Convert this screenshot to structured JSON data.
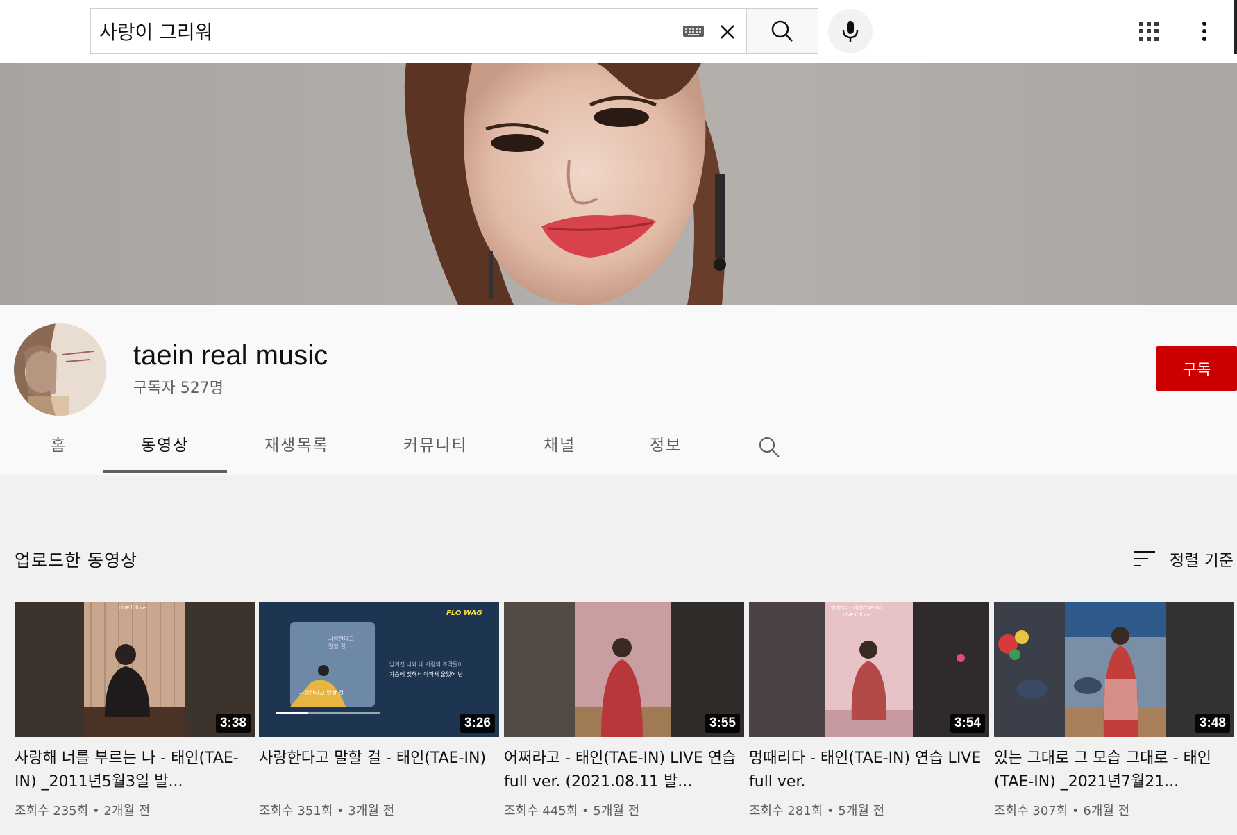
{
  "search": {
    "query": "사랑이 그리워"
  },
  "channel": {
    "name": "taein real music",
    "subscribers": "구독자 527명",
    "subscribe_label": "구독",
    "accent_color": "#cc0000"
  },
  "tabs": [
    {
      "label": "홈"
    },
    {
      "label": "동영상"
    },
    {
      "label": "재생목록"
    },
    {
      "label": "커뮤니티"
    },
    {
      "label": "채널"
    },
    {
      "label": "정보"
    }
  ],
  "active_tab": "동영상",
  "section": {
    "title": "업로드한 동영상",
    "sort_label": "정렬 기준"
  },
  "videos": [
    {
      "title": "사랑해 너를 부르는 나 - 태인(TAE-IN) _2011년5월3일 발...",
      "duration": "3:38",
      "views": "조회수 235회",
      "age": "2개월 전"
    },
    {
      "title": "사랑한다고 말할 걸 - 태인(TAE-IN)",
      "duration": "3:26",
      "views": "조회수 351회",
      "age": "3개월 전"
    },
    {
      "title": "어쩌라고 - 태인(TAE-IN) LIVE 연습 full ver. (2021.08.11 발...",
      "duration": "3:55",
      "views": "조회수 445회",
      "age": "5개월 전"
    },
    {
      "title": "멍때리다 - 태인(TAE-IN) 연습 LIVE full ver.",
      "duration": "3:54",
      "views": "조회수 281회",
      "age": "5개월 전"
    },
    {
      "title": "있는 그대로 그 모습 그대로 - 태인(TAE-IN) _2021년7월21...",
      "duration": "3:48",
      "views": "조회수 307회",
      "age": "6개월 전"
    }
  ],
  "thumb_text": {
    "v1_caption": "LIVE full ver.",
    "v2_logo": "FLO WAG",
    "v2_song": "사랑한다고 말할 걸",
    "v2_lyric1": "남겨진 너와 내 사랑의 조각들이",
    "v2_lyric2": "가슴에 맺혀서 아파서 울었어 난",
    "v4_caption1": "멍때리다 - 태인(TAE-IN)",
    "v4_caption2": "LIVE full ver."
  }
}
